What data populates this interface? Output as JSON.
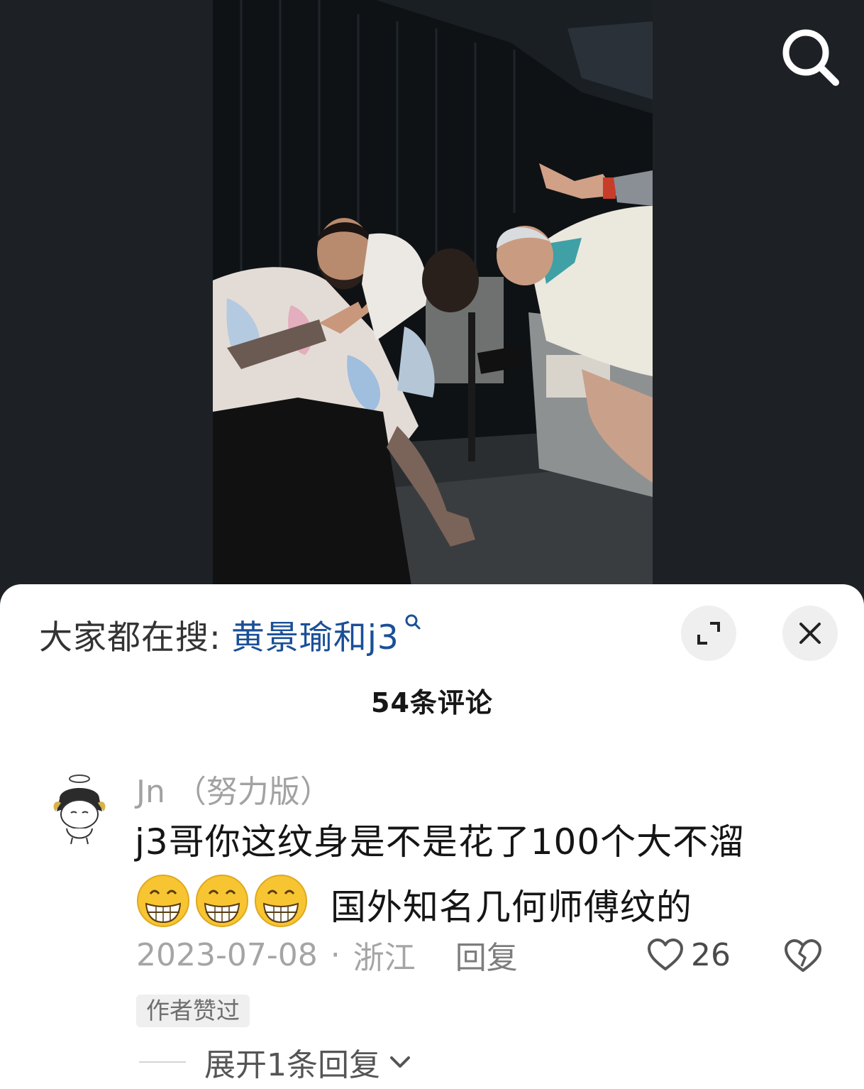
{
  "video": {
    "photo_desc_icon": "photo-of-three-men-at-night"
  },
  "top_bar": {
    "search_icon": "search-icon"
  },
  "comments_sheet": {
    "trending_label": "大家都在搜:",
    "trending_query": "黄景瑜和j3",
    "trending_icon": "search-small-icon",
    "expand_icon": "expand-icon",
    "close_icon": "close-icon",
    "comment_count": "54条评论",
    "comment": {
      "username": "Jn （努力版）",
      "text_line1": "j3哥你这纹身是不是花了100个大不溜",
      "emojis": [
        "grinning-face-emoji",
        "grinning-face-emoji",
        "grinning-face-emoji"
      ],
      "text_line2": "国外知名几何师傅纹的",
      "date": "2023-07-08",
      "separator": "·",
      "location": "浙江",
      "reply_label": "回复",
      "like_count": "26",
      "author_badge": "作者赞过",
      "expand_replies": "展开1条回复"
    }
  },
  "colors": {
    "background_dark": "#1d2125",
    "link_blue": "#1b4f96",
    "sheet_bg": "#ffffff",
    "meta_gray": "#a5a5a5"
  }
}
